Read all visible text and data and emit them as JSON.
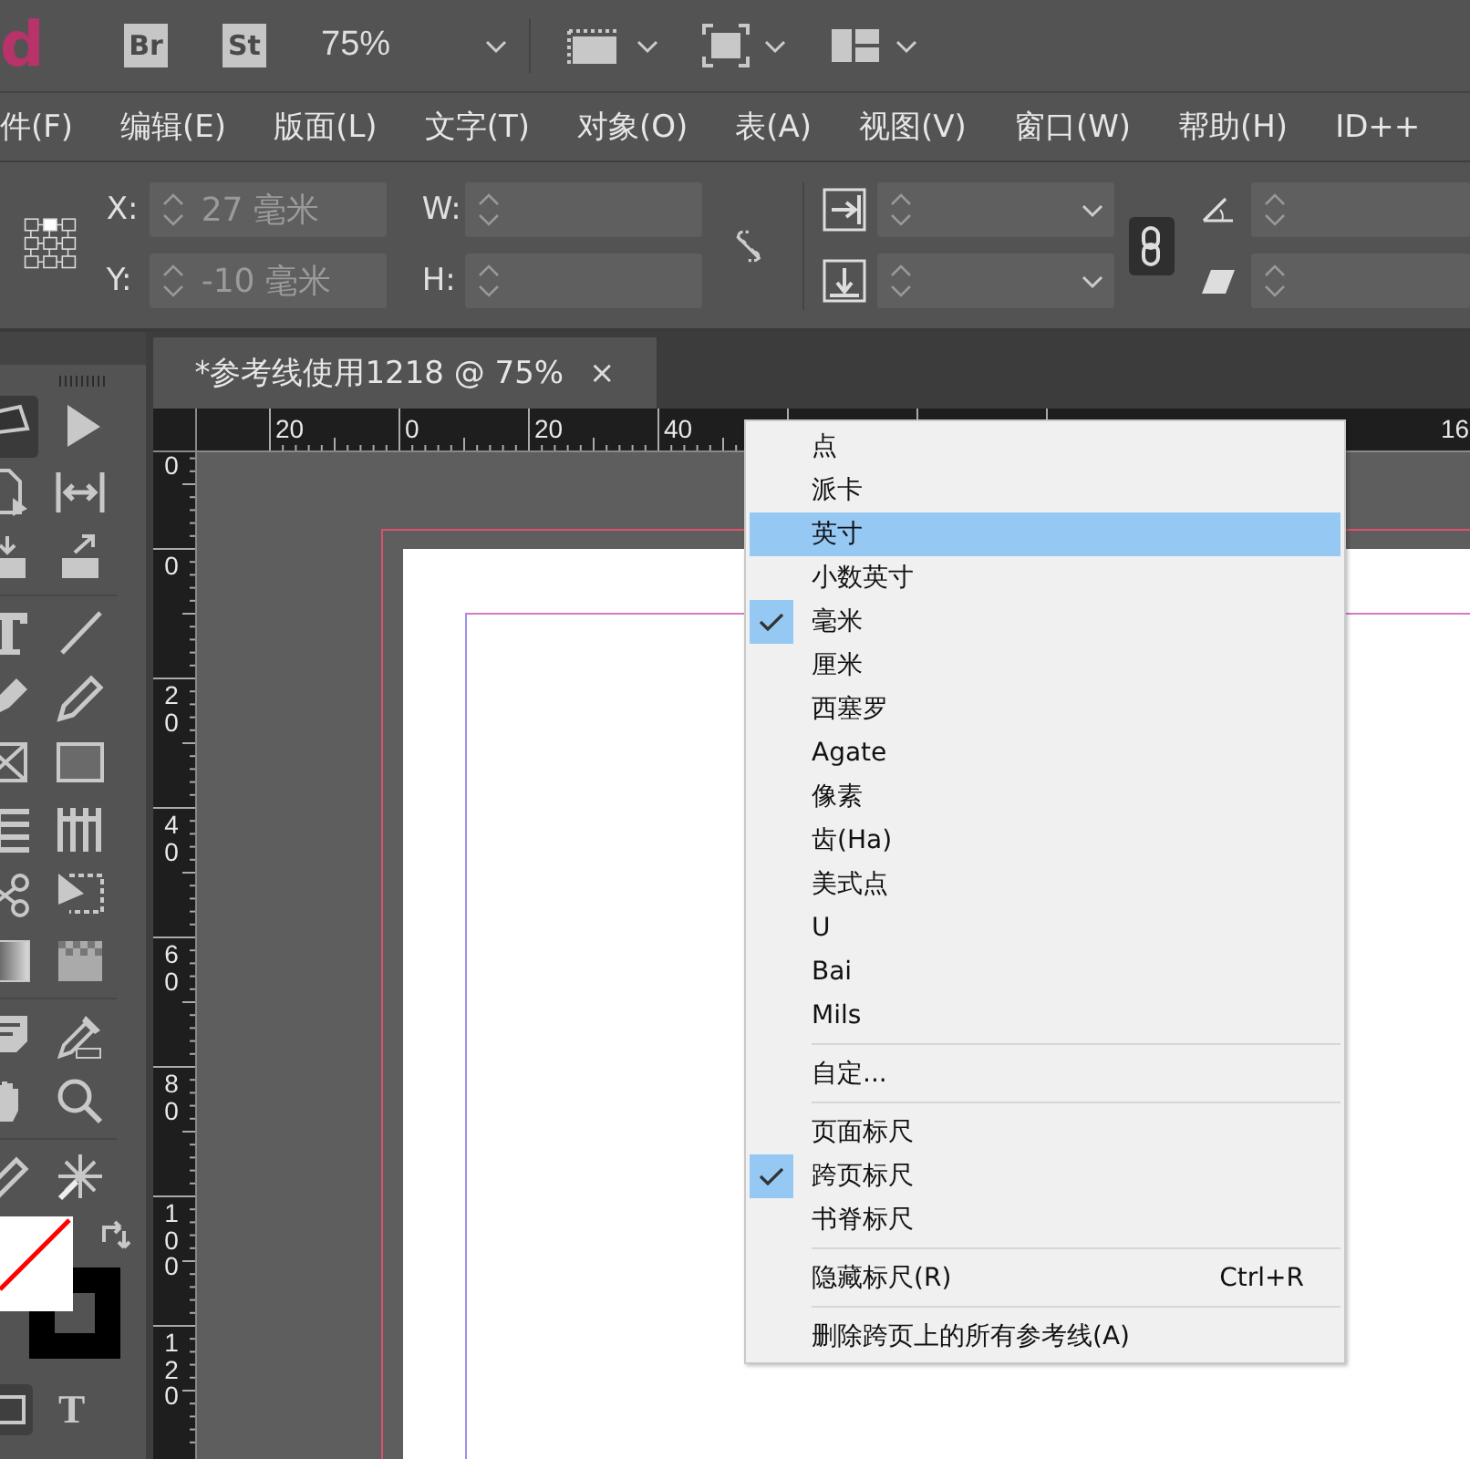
{
  "app_bar": {
    "logo": "d",
    "bridge": "Br",
    "stock": "St",
    "zoom": "75%"
  },
  "menu_bar": [
    "件(F)",
    "编辑(E)",
    "版面(L)",
    "文字(T)",
    "对象(O)",
    "表(A)",
    "视图(V)",
    "窗口(W)",
    "帮助(H)",
    "ID++"
  ],
  "control_panel": {
    "x_label": "X:",
    "x_value": "27 毫米",
    "y_label": "Y:",
    "y_value": "-10 毫米",
    "w_label": "W:",
    "h_label": "H:"
  },
  "document_tab": {
    "title": "*参考线使用1218 @ 75%",
    "close": "×",
    "selected": true
  },
  "top_ruler": [
    "20",
    "0",
    "20",
    "40",
    "16"
  ],
  "left_ruler": [
    "0",
    "0",
    "20",
    "40",
    "60",
    "80",
    "100",
    "120"
  ],
  "tools": {
    "formatting_text": "T"
  },
  "context_menu": [
    {
      "kind": "item",
      "label": "点",
      "checked": false,
      "selected": false
    },
    {
      "kind": "item",
      "label": "派卡",
      "checked": false,
      "selected": false
    },
    {
      "kind": "item",
      "label": "英寸",
      "checked": false,
      "selected": true
    },
    {
      "kind": "item",
      "label": "小数英寸",
      "checked": false,
      "selected": false
    },
    {
      "kind": "item",
      "label": "毫米",
      "checked": true,
      "selected": false
    },
    {
      "kind": "item",
      "label": "厘米",
      "checked": false,
      "selected": false
    },
    {
      "kind": "item",
      "label": "西塞罗",
      "checked": false,
      "selected": false
    },
    {
      "kind": "item",
      "label": "Agate",
      "checked": false,
      "selected": false
    },
    {
      "kind": "item",
      "label": "像素",
      "checked": false,
      "selected": false
    },
    {
      "kind": "item",
      "label": "齿(Ha)",
      "checked": false,
      "selected": false
    },
    {
      "kind": "item",
      "label": "美式点",
      "checked": false,
      "selected": false
    },
    {
      "kind": "item",
      "label": "U",
      "checked": false,
      "selected": false
    },
    {
      "kind": "item",
      "label": "Bai",
      "checked": false,
      "selected": false
    },
    {
      "kind": "item",
      "label": "Mils",
      "checked": false,
      "selected": false
    },
    {
      "kind": "separator"
    },
    {
      "kind": "item",
      "label": "自定...",
      "checked": false,
      "selected": false
    },
    {
      "kind": "separator"
    },
    {
      "kind": "item",
      "label": "页面标尺",
      "checked": false,
      "selected": false
    },
    {
      "kind": "item",
      "label": "跨页标尺",
      "checked": true,
      "selected": false
    },
    {
      "kind": "item",
      "label": "书脊标尺",
      "checked": false,
      "selected": false
    },
    {
      "kind": "separator"
    },
    {
      "kind": "item",
      "label": "隐藏标尺(R)",
      "shortcut": "Ctrl+R",
      "checked": false,
      "selected": false
    },
    {
      "kind": "separator"
    },
    {
      "kind": "item",
      "label": "删除跨页上的所有参考线(A)",
      "checked": false,
      "selected": false
    }
  ]
}
